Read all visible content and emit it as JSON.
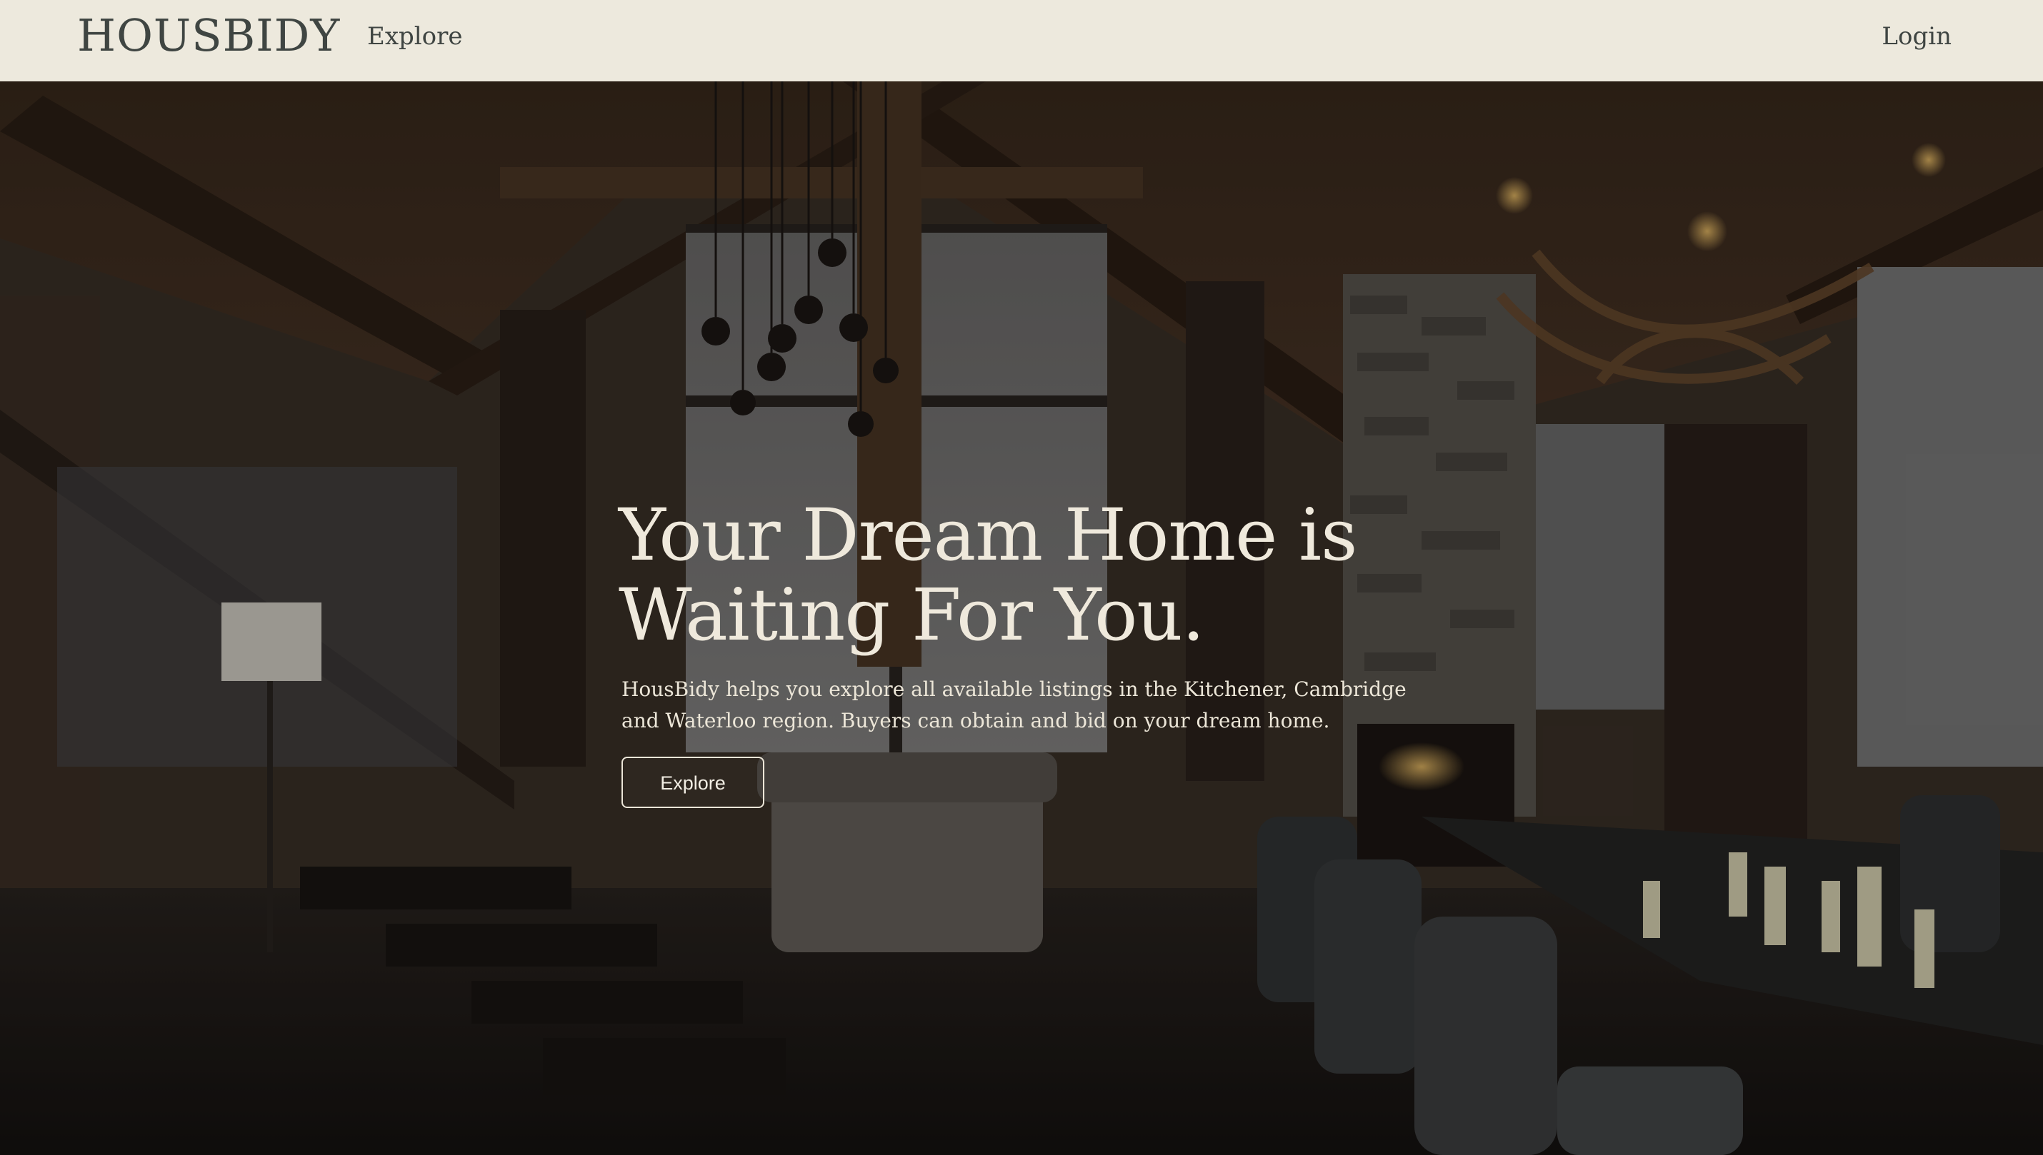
{
  "navbar": {
    "brand": "HOUSBIDY",
    "explore_label": "Explore",
    "login_label": "Login"
  },
  "hero": {
    "title_line1": "Your Dream Home is",
    "title_line2": "Waiting For You.",
    "description": "HousBidy helps you explore all available listings in the Kitchener, Cambridge and Waterloo region. Buyers can obtain and bid on your dream home.",
    "button_label": "Explore"
  },
  "colors": {
    "navbar_bg": "#ede9dd",
    "navbar_text": "#3f4542",
    "hero_text": "#efe9dc"
  }
}
